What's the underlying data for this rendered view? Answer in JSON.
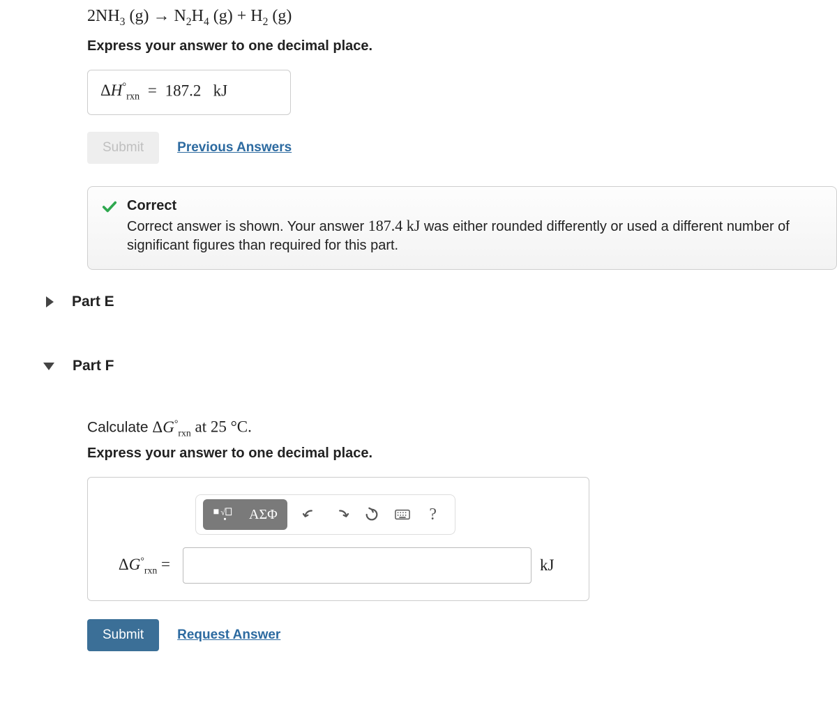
{
  "partD": {
    "equation_html": "2NH<sub>3</sub> (g) → N<sub>2</sub>H<sub>4</sub> (g) + H<sub>2</sub> (g)",
    "prompt": "Express your answer to one decimal place.",
    "answer_label_html": "Δ<i>H</i><sup>°</sup><sub>rxn</sub>",
    "answer_value": "187.2",
    "answer_unit": "kJ",
    "equals": "=",
    "submit_label": "Submit",
    "prev_answers_label": "Previous Answers",
    "feedback": {
      "title": "Correct",
      "body_prefix": "Correct answer is shown. Your answer ",
      "user_value": "187.4 kJ",
      "body_suffix": " was either rounded differently or used a different number of significant figures than required for this part."
    }
  },
  "partE": {
    "title": "Part E"
  },
  "partF": {
    "title": "Part F",
    "calc_prefix": "Calculate ",
    "symbol_html": "Δ<i>G</i><sup>°</sup><sub>rxn</sub>",
    "calc_suffix_html": " at 25 °C.",
    "prompt": "Express your answer to one decimal place.",
    "toolbar": {
      "templates": "templates-icon",
      "greek": "ΑΣΦ",
      "undo": "undo-icon",
      "redo": "redo-icon",
      "reset": "reset-icon",
      "keyboard": "keyboard-icon",
      "help": "?"
    },
    "input_label_html": "Δ<i>G</i><sup>°</sup><sub>rxn</sub>",
    "equals": "=",
    "input_value": "",
    "unit": "kJ",
    "submit_label": "Submit",
    "request_answer_label": "Request Answer"
  }
}
